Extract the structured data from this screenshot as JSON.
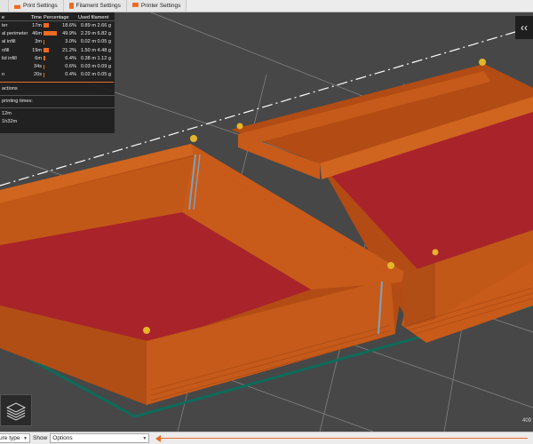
{
  "tabs": [
    {
      "label": "Print Settings",
      "icon": "print-settings-icon"
    },
    {
      "label": "Filament Settings",
      "icon": "filament-spool-icon"
    },
    {
      "label": "Printer Settings",
      "icon": "printer-icon"
    }
  ],
  "legend": {
    "headers": {
      "type": "e",
      "time": "Time",
      "percentage": "Percentage",
      "used_filament": "Used filament"
    },
    "rows": [
      {
        "name": "ter",
        "time": "17m",
        "bar": 0.186,
        "percent": "18.6%",
        "length": "0.89 m",
        "weight": "2.66 g"
      },
      {
        "name": "al perimeter",
        "time": "46m",
        "bar": 0.499,
        "percent": "49.9%",
        "length": "2.29 m",
        "weight": "6.82 g"
      },
      {
        "name": "al infill",
        "time": "3m",
        "bar": 0.03,
        "percent": "3.0%",
        "length": "0.02 m",
        "weight": "0.05 g"
      },
      {
        "name": "nfill",
        "time": "19m",
        "bar": 0.212,
        "percent": "21.2%",
        "length": "1.50 m",
        "weight": "4.48 g"
      },
      {
        "name": "lid infill",
        "time": "6m",
        "bar": 0.064,
        "percent": "6.4%",
        "length": "0.38 m",
        "weight": "1.12 g"
      },
      {
        "name": "",
        "time": "34s",
        "bar": 0.006,
        "percent": "0.6%",
        "length": "0.03 m",
        "weight": "0.09 g"
      },
      {
        "name": "n",
        "time": "20s",
        "bar": 0.004,
        "percent": "0.4%",
        "length": "0.02 m",
        "weight": "0.05 g"
      }
    ],
    "actions_label": "actions",
    "times_label": "printing times:",
    "time_first": "12m",
    "time_second": "1h32m",
    "accent": "#ed6b21"
  },
  "viewport": {
    "colors": {
      "background": "#474747",
      "wall": "#c85a1a",
      "wall_dark": "#a94a12",
      "floor": "#a8232a",
      "bed_edge": "#0e6b5a",
      "grid": "#ffffff"
    },
    "coordinate_label": "409"
  },
  "bottom": {
    "view_type": "ure type",
    "show_label": "Show",
    "show_value": "Options"
  }
}
